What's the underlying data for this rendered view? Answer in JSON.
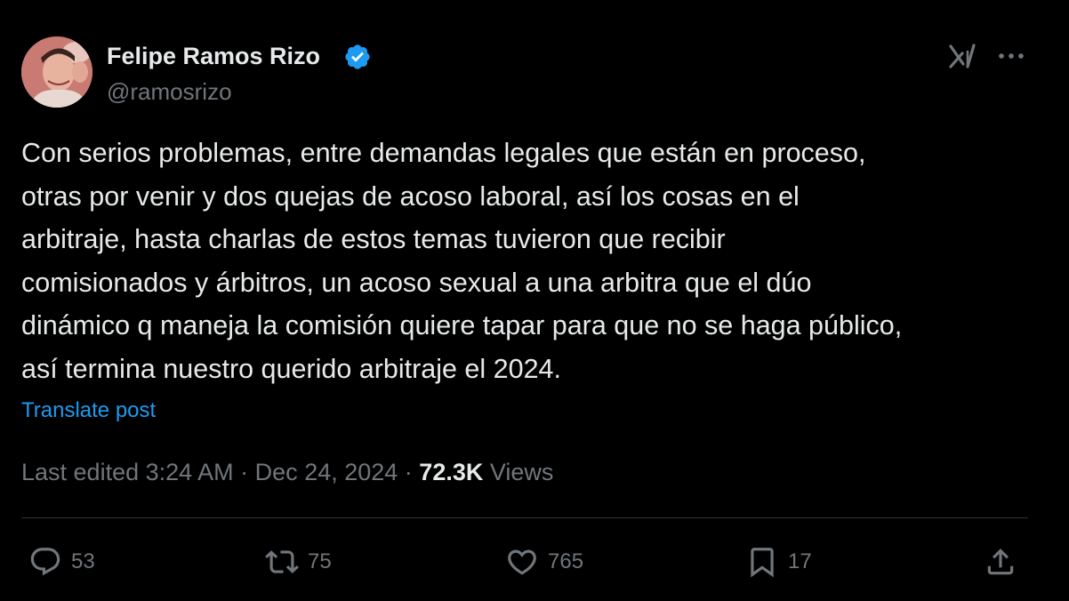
{
  "author": {
    "display_name": "Felipe Ramos Rizo",
    "handle": "@ramosrizo",
    "verified": true,
    "avatar_icon": "profile-photo"
  },
  "header_icons": {
    "grok": "grok-icon",
    "more": "more-icon"
  },
  "post": {
    "text": "Con serios problemas, entre demandas legales que están en proceso,\notras por venir y dos quejas de acoso laboral, así los cosas en el\narbitraje, hasta charlas de estos temas tuvieron que recibir\ncomisionados y árbitros, un acoso sexual  a una arbitra que el dúo\ndinámico q maneja la comisión quiere tapar para que no se haga público,\nasí termina nuestro querido arbitraje el 2024.",
    "translate_label": "Translate post"
  },
  "meta": {
    "edited_prefix": "Last edited ",
    "time": "3:24 AM",
    "separator1": " · ",
    "date": "Dec 24, 2024",
    "separator2": " · ",
    "views_count": "72.3K",
    "views_label": " Views"
  },
  "actions": {
    "reply_count": "53",
    "repost_count": "75",
    "like_count": "765",
    "bookmark_count": "17"
  },
  "colors": {
    "background": "#000000",
    "text": "#e7e9ea",
    "muted": "#71767b",
    "link": "#1d9bf0",
    "verified": "#1d9bf0",
    "divider": "#2f3336"
  }
}
